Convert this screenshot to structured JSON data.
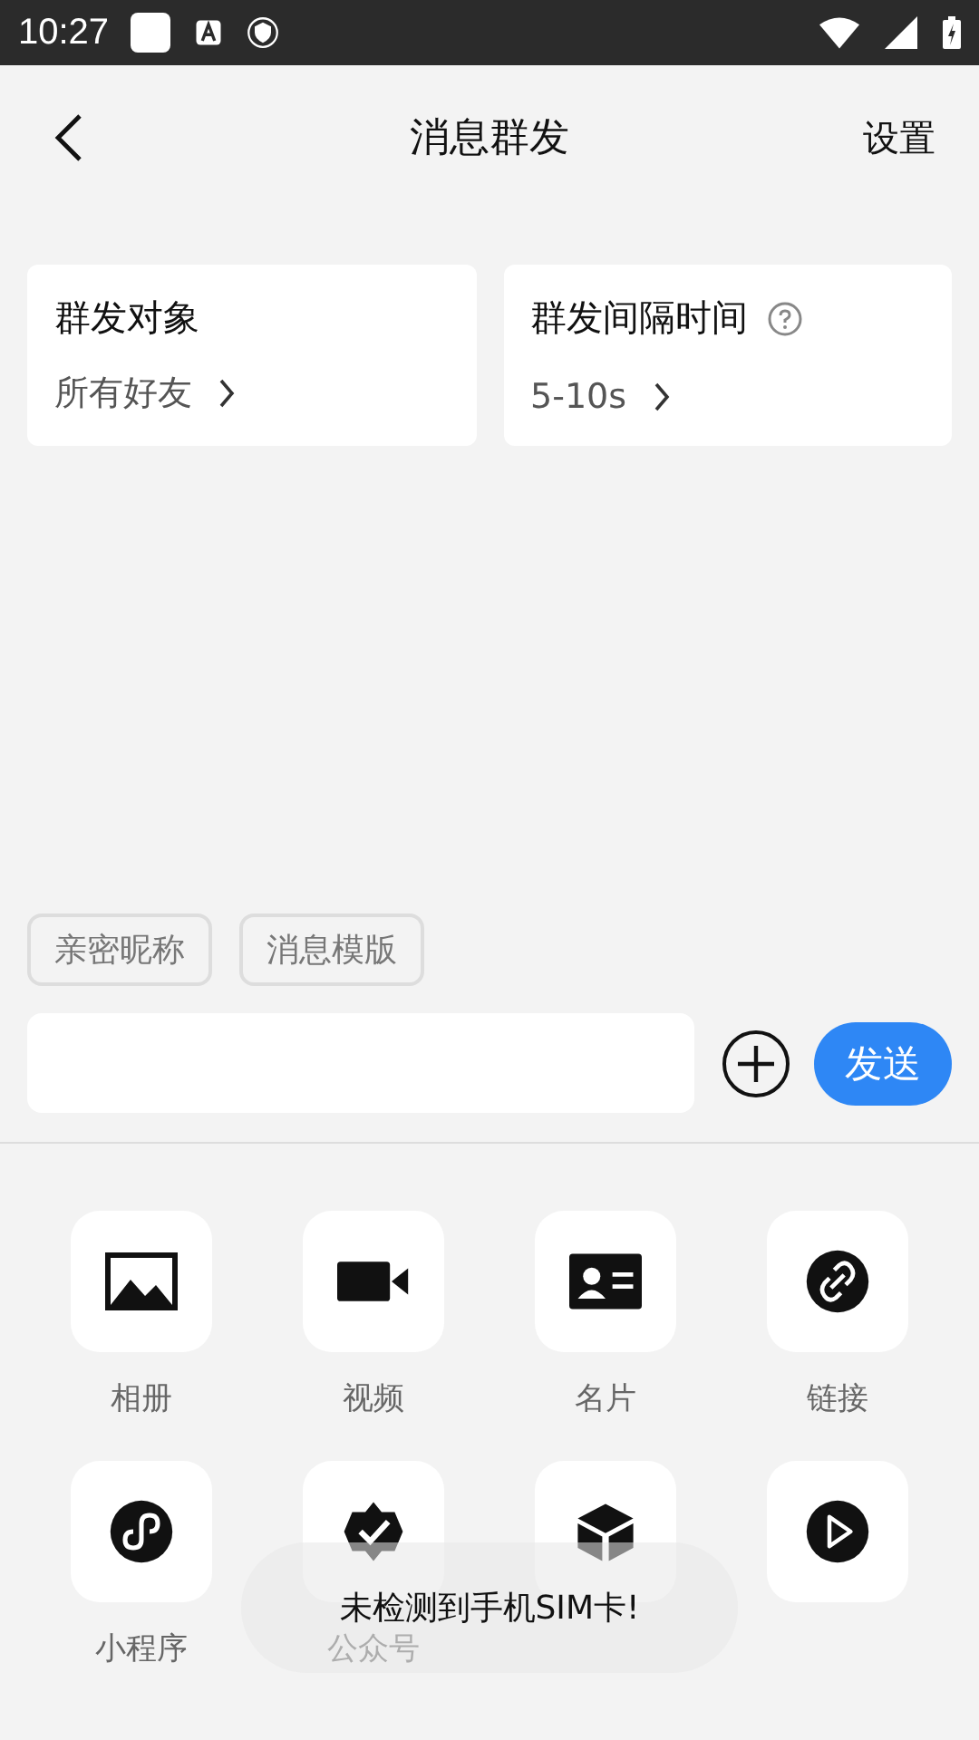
{
  "status_bar": {
    "time": "10:27"
  },
  "header": {
    "title": "消息群发",
    "action": "设置"
  },
  "cards": [
    {
      "title": "群发对象",
      "value": "所有好友",
      "help": false
    },
    {
      "title": "群发间隔时间",
      "value": "5-10s",
      "help": true
    }
  ],
  "tags": [
    "亲密昵称",
    "消息模版"
  ],
  "composer": {
    "send": "发送"
  },
  "attachments": [
    {
      "kind": "photo",
      "label": "相册"
    },
    {
      "kind": "video",
      "label": "视频"
    },
    {
      "kind": "card",
      "label": "名片"
    },
    {
      "kind": "link",
      "label": "链接"
    },
    {
      "kind": "miniapp",
      "label": "小程序"
    },
    {
      "kind": "badge",
      "label": "公众号"
    },
    {
      "kind": "box"
    },
    {
      "kind": "play"
    }
  ],
  "toast": "未检测到手机SIM卡!"
}
